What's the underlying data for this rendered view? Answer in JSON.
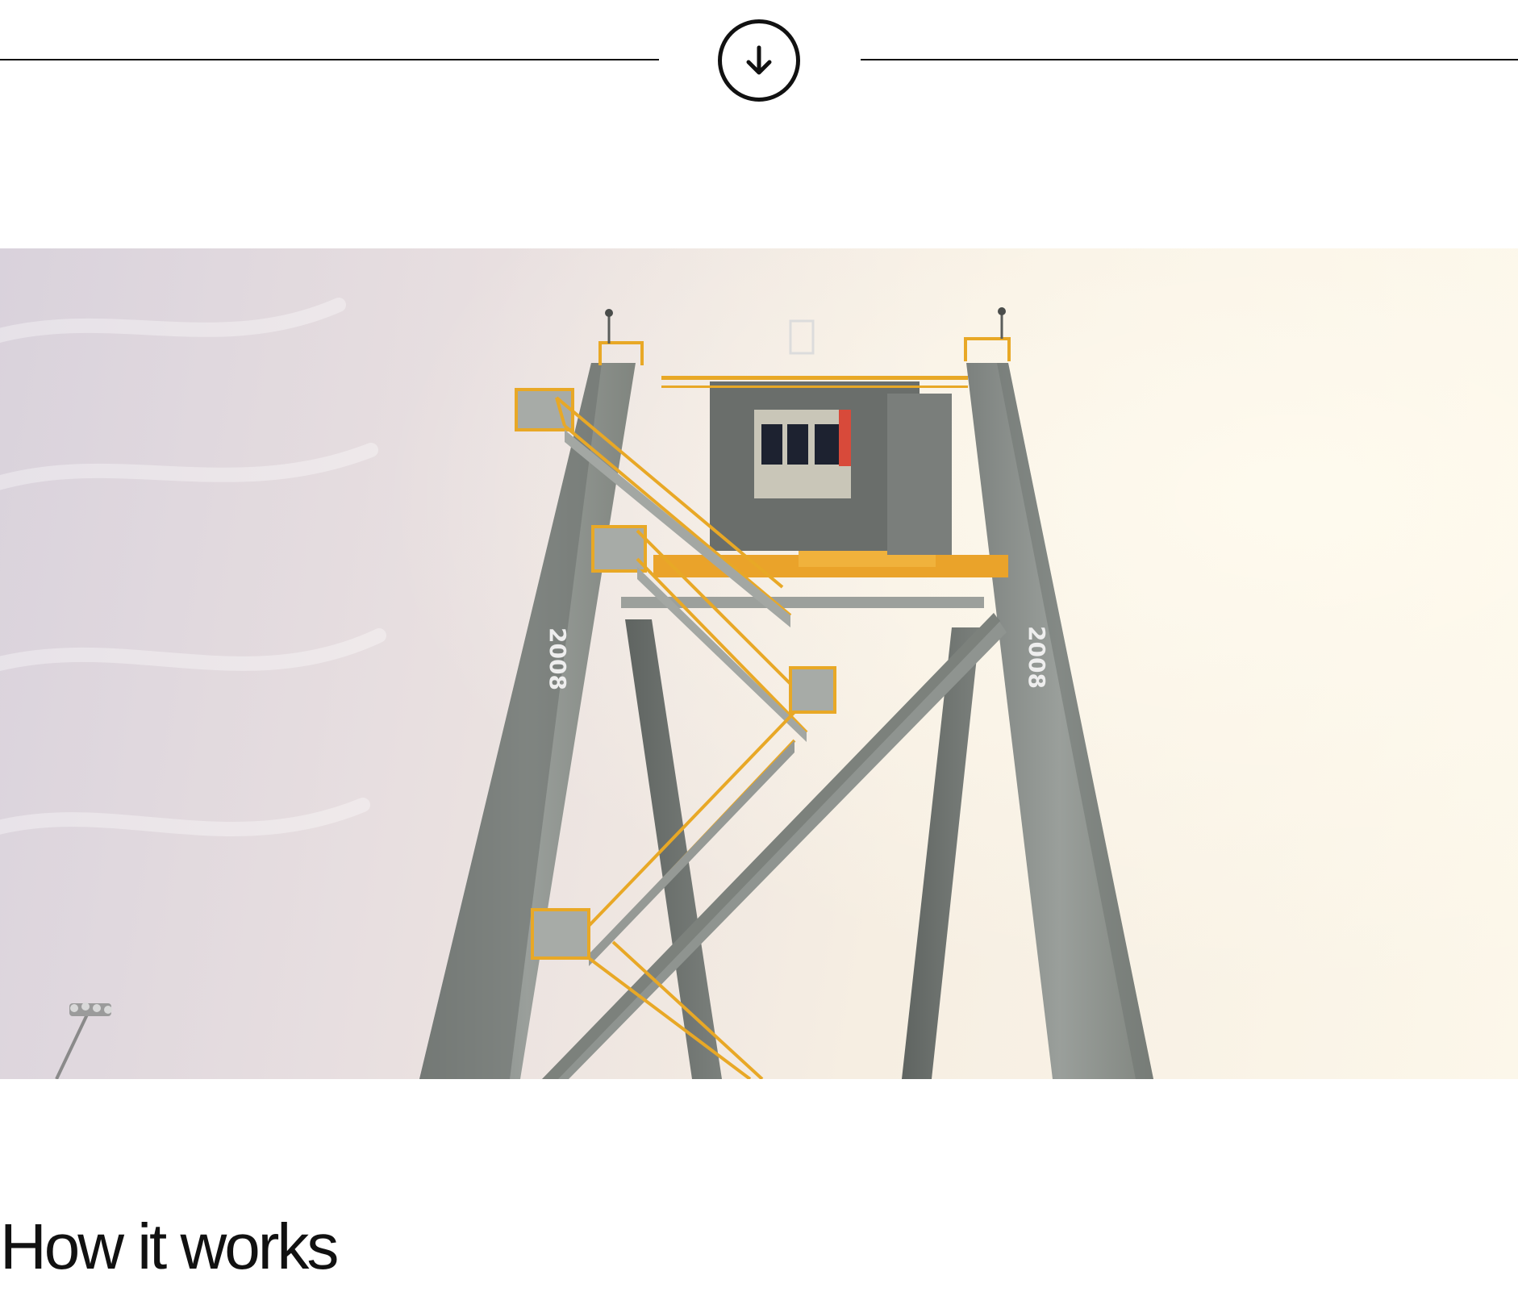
{
  "scroll_down": {
    "icon": "arrow-down-circle-icon"
  },
  "hero": {
    "alt": "Gantry crane with yellow staircases against the sky",
    "crane_year_marking": "2008"
  },
  "section": {
    "title": "How it works"
  },
  "colors": {
    "text": "#111111",
    "background": "#ffffff",
    "crane_steel": "#8c918d",
    "railing_yellow": "#e8a826",
    "sky_left": "#d9d2dc",
    "sky_right": "#fcf7ea"
  }
}
